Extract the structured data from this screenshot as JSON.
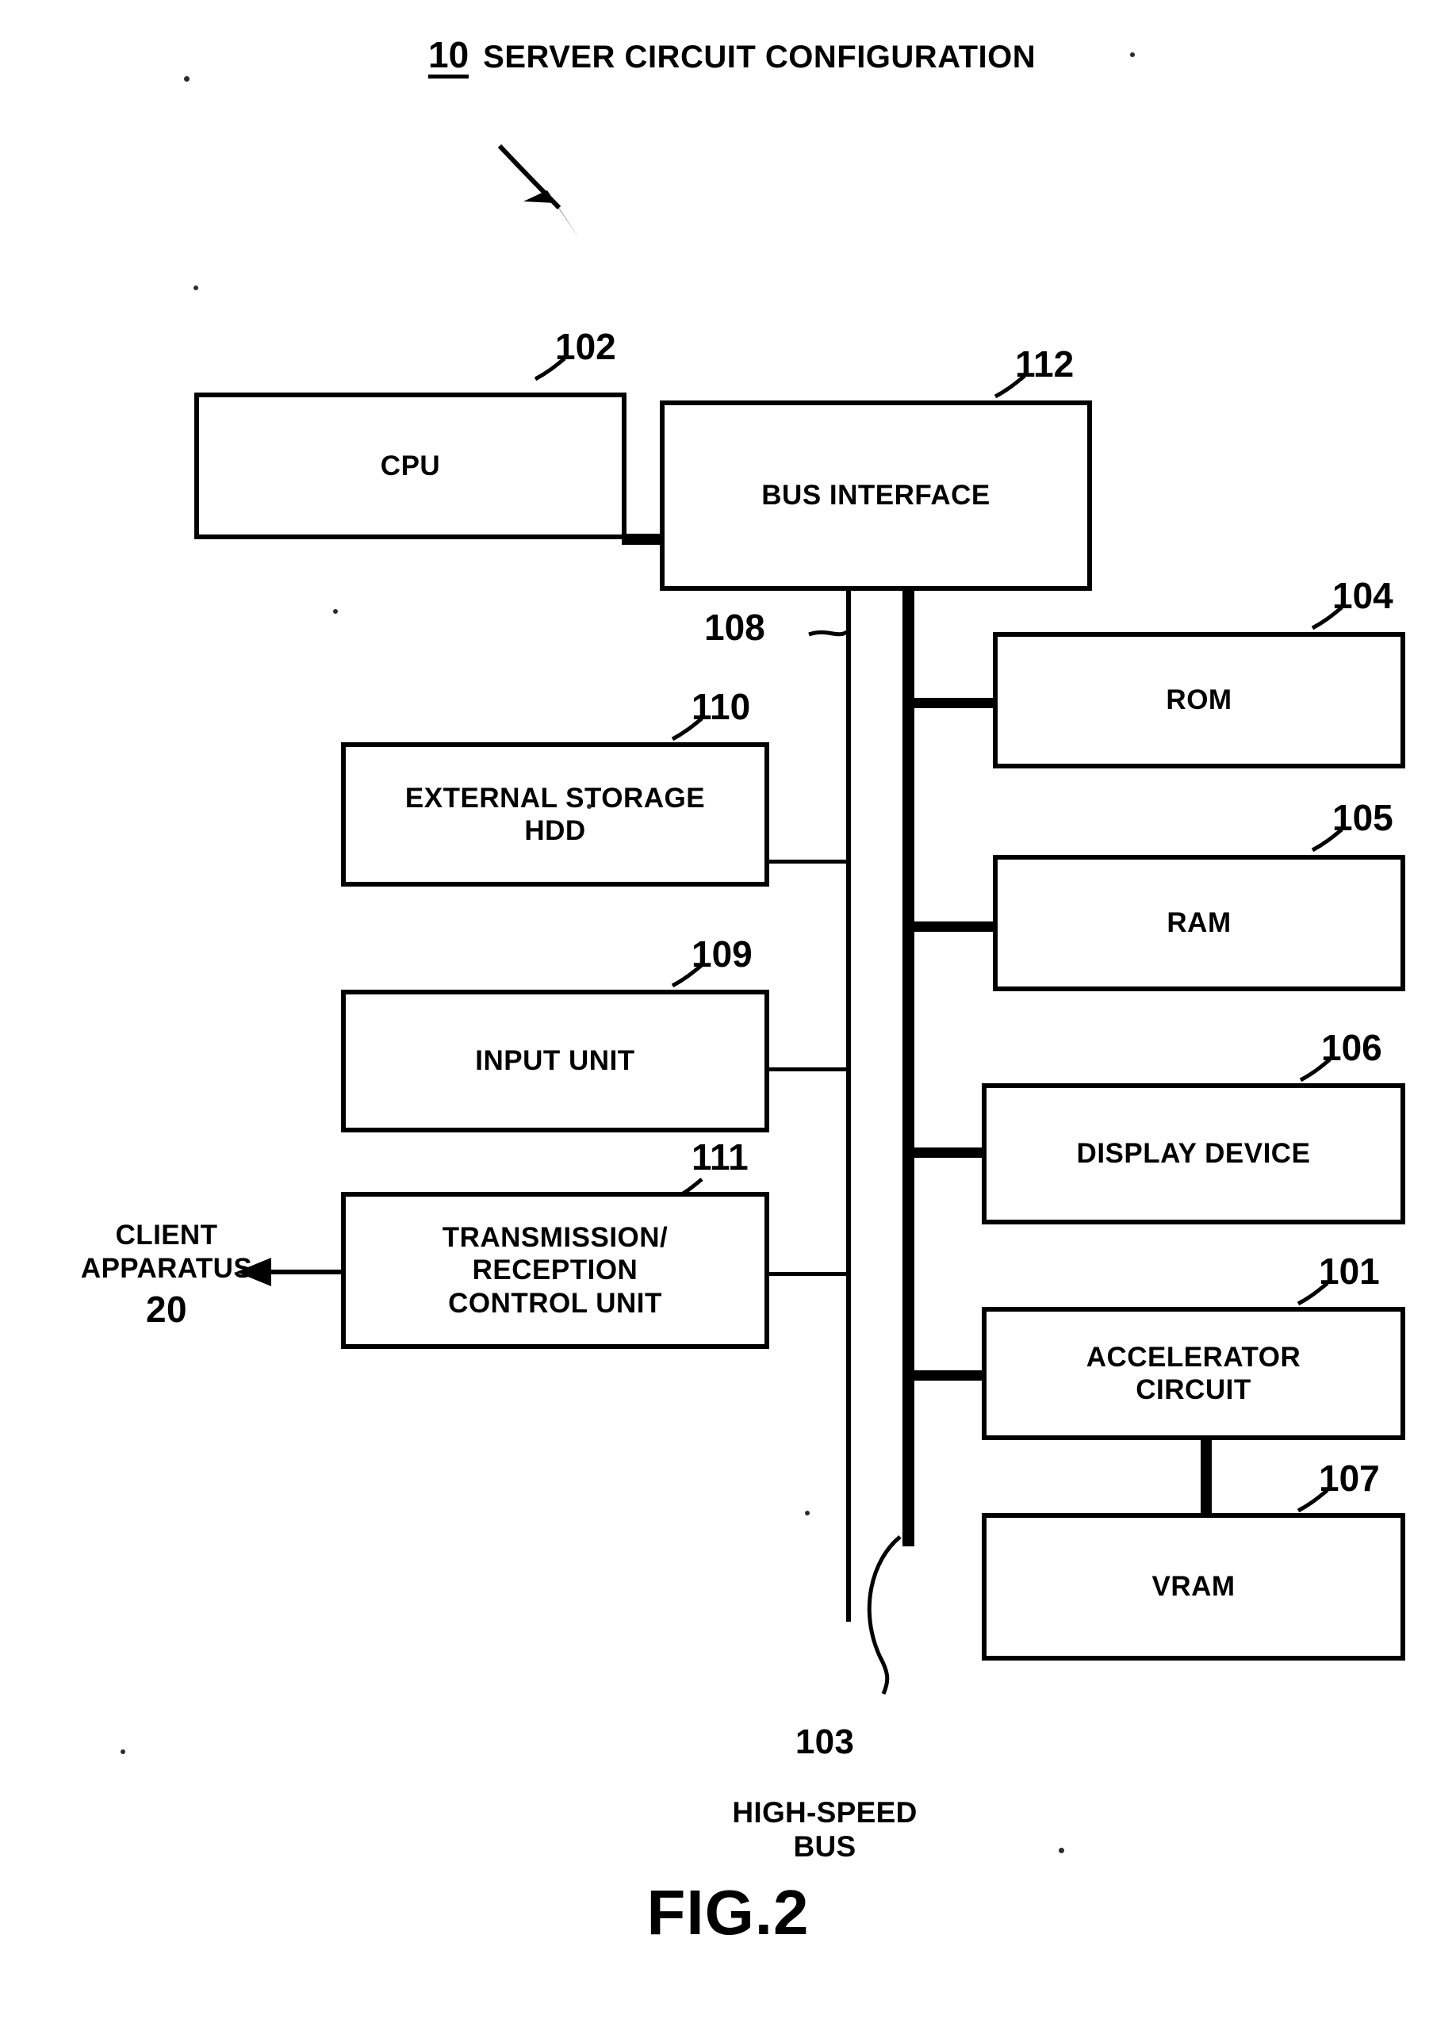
{
  "figure": {
    "caption": "FIG.2",
    "title_ref": "10",
    "title_text": "SERVER CIRCUIT CONFIGURATION"
  },
  "blocks": {
    "cpu": {
      "ref": "102",
      "label": "CPU"
    },
    "bus_if": {
      "ref": "112",
      "label": "BUS INTERFACE"
    },
    "rom": {
      "ref": "104",
      "label": "ROM"
    },
    "ram": {
      "ref": "105",
      "label": "RAM"
    },
    "display": {
      "ref": "106",
      "label": "DISPLAY DEVICE"
    },
    "accelerator": {
      "ref": "101",
      "label": "ACCELERATOR\nCIRCUIT"
    },
    "vram": {
      "ref": "107",
      "label": "VRAM"
    },
    "storage": {
      "ref": "110",
      "label": "EXTERNAL STORAGE\nHDD"
    },
    "input": {
      "ref": "109",
      "label": "INPUT UNIT"
    },
    "txrx": {
      "ref": "111",
      "label": "TRANSMISSION/\nRECEPTION\nCONTROL UNIT"
    }
  },
  "buses": {
    "internal_bus_ref": "108",
    "high_speed_bus_ref": "103",
    "high_speed_bus_label": "HIGH-SPEED\nBUS"
  },
  "external": {
    "client_label": "CLIENT\nAPPARATUS",
    "client_ref": "20"
  },
  "colors": {
    "ink": "#000000",
    "paper": "#ffffff"
  },
  "chart_data": {
    "type": "diagram",
    "title": "10 SERVER CIRCUIT CONFIGURATION",
    "nodes": [
      {
        "ref": "102",
        "label": "CPU"
      },
      {
        "ref": "112",
        "label": "BUS INTERFACE"
      },
      {
        "ref": "104",
        "label": "ROM"
      },
      {
        "ref": "105",
        "label": "RAM"
      },
      {
        "ref": "106",
        "label": "DISPLAY DEVICE"
      },
      {
        "ref": "101",
        "label": "ACCELERATOR CIRCUIT"
      },
      {
        "ref": "107",
        "label": "VRAM"
      },
      {
        "ref": "110",
        "label": "EXTERNAL STORAGE HDD"
      },
      {
        "ref": "109",
        "label": "INPUT UNIT"
      },
      {
        "ref": "111",
        "label": "TRANSMISSION/RECEPTION CONTROL UNIT"
      },
      {
        "ref": "108",
        "label": "BUS"
      },
      {
        "ref": "103",
        "label": "HIGH-SPEED BUS"
      },
      {
        "ref": "20",
        "label": "CLIENT APPARATUS"
      }
    ],
    "edges": [
      {
        "from": "102",
        "to": "112",
        "style": "thick"
      },
      {
        "from": "112",
        "to": "108",
        "style": "thin"
      },
      {
        "from": "112",
        "to": "103",
        "style": "thick"
      },
      {
        "from": "108",
        "to": "110",
        "style": "thin"
      },
      {
        "from": "108",
        "to": "109",
        "style": "thin"
      },
      {
        "from": "108",
        "to": "111",
        "style": "thin"
      },
      {
        "from": "103",
        "to": "104",
        "style": "thick"
      },
      {
        "from": "103",
        "to": "105",
        "style": "thick"
      },
      {
        "from": "103",
        "to": "106",
        "style": "thick"
      },
      {
        "from": "103",
        "to": "101",
        "style": "thick"
      },
      {
        "from": "101",
        "to": "107",
        "style": "thick"
      },
      {
        "from": "111",
        "to": "20",
        "style": "arrow"
      }
    ]
  }
}
